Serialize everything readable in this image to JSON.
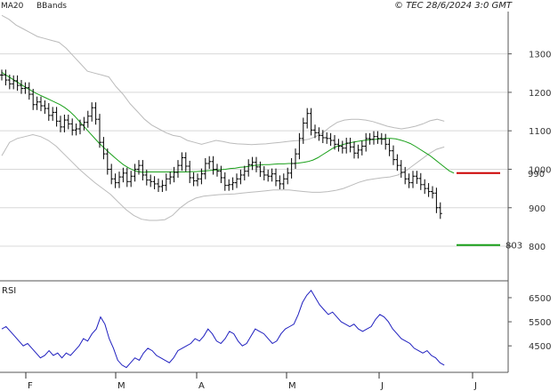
{
  "chart_data": {
    "type": "ohlc",
    "copyright": "© TEC 28/6/2024 3:0 GMT",
    "legend": {
      "ma": "MA20",
      "bbands": "BBands"
    },
    "colors": {
      "bar": "#000000",
      "ma": "#1aa01a",
      "bband": "#bbbbbb",
      "rsi": "#1f1fbf",
      "resistance": "#cc0000",
      "support": "#1aa01a",
      "grid": "#d8d8d8"
    },
    "x_months": [
      "F",
      "M",
      "A",
      "M",
      "J",
      "J"
    ],
    "price_axis": {
      "ticks": [
        800,
        900,
        1000,
        1100,
        1200,
        1300
      ],
      "ylim": [
        710,
        1410
      ],
      "grid": true
    },
    "rsi_axis": {
      "label": "RSI",
      "ticks": [
        45,
        55,
        65
      ],
      "tick_labels": [
        "4500",
        "5500",
        "6500"
      ],
      "ylim": [
        34,
        72
      ]
    },
    "levels": [
      {
        "name": "resistance",
        "value": 990,
        "label": "990"
      },
      {
        "name": "support",
        "value": 803,
        "label": "803"
      }
    ],
    "close": [
      1245,
      1232,
      1222,
      1230,
      1218,
      1210,
      1212,
      1195,
      1168,
      1175,
      1165,
      1158,
      1140,
      1148,
      1125,
      1110,
      1128,
      1118,
      1102,
      1105,
      1115,
      1122,
      1138,
      1160,
      1130,
      1070,
      1040,
      1000,
      975,
      965,
      980,
      990,
      968,
      982,
      1000,
      1010,
      985,
      972,
      968,
      962,
      955,
      958,
      975,
      980,
      992,
      1010,
      1030,
      1008,
      978,
      970,
      975,
      988,
      1015,
      1020,
      1000,
      995,
      978,
      958,
      960,
      965,
      975,
      985,
      995,
      1012,
      1018,
      1006,
      994,
      985,
      982,
      988,
      970,
      962,
      975,
      990,
      1015,
      1040,
      1080,
      1120,
      1145,
      1102,
      1095,
      1088,
      1082,
      1080,
      1075,
      1065,
      1060,
      1055,
      1068,
      1058,
      1042,
      1050,
      1060,
      1080,
      1078,
      1085,
      1080,
      1078,
      1065,
      1048,
      1025,
      1010,
      992,
      975,
      965,
      982,
      976,
      960,
      950,
      942,
      938,
      900,
      885
    ],
    "ma20": [
      1252,
      1244,
      1236,
      1228,
      1220,
      1212,
      1205,
      1198,
      1192,
      1186,
      1180,
      1174,
      1168,
      1160,
      1150,
      1138,
      1124,
      1110,
      1096,
      1082,
      1068,
      1056,
      1044,
      1033,
      1022,
      1012,
      1004,
      998,
      994,
      992,
      993,
      993,
      993,
      993,
      993,
      993,
      993,
      993,
      993,
      994,
      994,
      995,
      996,
      997,
      998,
      999,
      1000,
      1002,
      1003,
      1005,
      1006,
      1008,
      1010,
      1011,
      1012,
      1012,
      1013,
      1014,
      1014,
      1015,
      1015,
      1016,
      1018,
      1020,
      1024,
      1030,
      1038,
      1046,
      1054,
      1060,
      1064,
      1067,
      1070,
      1072,
      1074,
      1076,
      1077,
      1078,
      1079,
      1080,
      1080,
      1079,
      1076,
      1072,
      1067,
      1060,
      1052,
      1044,
      1036,
      1026,
      1016,
      1006,
      996,
      990
    ],
    "bb_upper": [
      1400,
      1390,
      1375,
      1365,
      1355,
      1345,
      1340,
      1335,
      1330,
      1315,
      1295,
      1275,
      1255,
      1250,
      1245,
      1240,
      1215,
      1195,
      1170,
      1150,
      1130,
      1115,
      1105,
      1095,
      1088,
      1085,
      1075,
      1070,
      1065,
      1070,
      1075,
      1072,
      1068,
      1066,
      1065,
      1064,
      1065,
      1066,
      1068,
      1070,
      1072,
      1074,
      1075,
      1078,
      1085,
      1095,
      1110,
      1122,
      1128,
      1130,
      1130,
      1128,
      1124,
      1118,
      1112,
      1108,
      1105,
      1108,
      1112,
      1118,
      1126,
      1130,
      1125
    ],
    "bb_lower": [
      1035,
      1070,
      1080,
      1085,
      1090,
      1085,
      1075,
      1060,
      1040,
      1020,
      1000,
      982,
      965,
      950,
      935,
      915,
      895,
      880,
      870,
      867,
      867,
      869,
      880,
      900,
      915,
      925,
      930,
      932,
      934,
      935,
      936,
      938,
      940,
      942,
      944,
      946,
      946,
      946,
      944,
      942,
      940,
      940,
      942,
      945,
      950,
      958,
      966,
      972,
      975,
      978,
      980,
      985,
      995,
      1010,
      1025,
      1040,
      1052,
      1058
    ],
    "rsi": [
      52,
      53,
      51,
      49,
      47,
      45,
      46,
      44,
      42,
      40,
      41,
      43,
      41,
      42,
      40,
      42,
      41,
      43,
      45,
      48,
      47,
      50,
      52,
      57,
      54,
      48,
      44,
      39,
      37,
      36,
      38,
      40,
      39,
      42,
      44,
      43,
      41,
      40,
      39,
      38,
      40,
      43,
      44,
      45,
      46,
      48,
      47,
      49,
      52,
      50,
      47,
      46,
      48,
      51,
      50,
      47,
      45,
      46,
      49,
      52,
      51,
      50,
      48,
      46,
      47,
      50,
      52,
      53,
      54,
      58,
      63,
      66,
      68,
      65,
      62,
      60,
      58,
      59,
      57,
      55,
      54,
      53,
      54,
      52,
      51,
      52,
      53,
      56,
      58,
      57,
      55,
      52,
      50,
      48,
      47,
      46,
      44,
      43,
      42,
      43,
      41,
      40,
      38,
      37
    ],
    "counts": {
      "n_bars": 114,
      "n_ma": 92,
      "n_bb": 63,
      "n_bbl": 58,
      "n_rsi": 104
    }
  }
}
